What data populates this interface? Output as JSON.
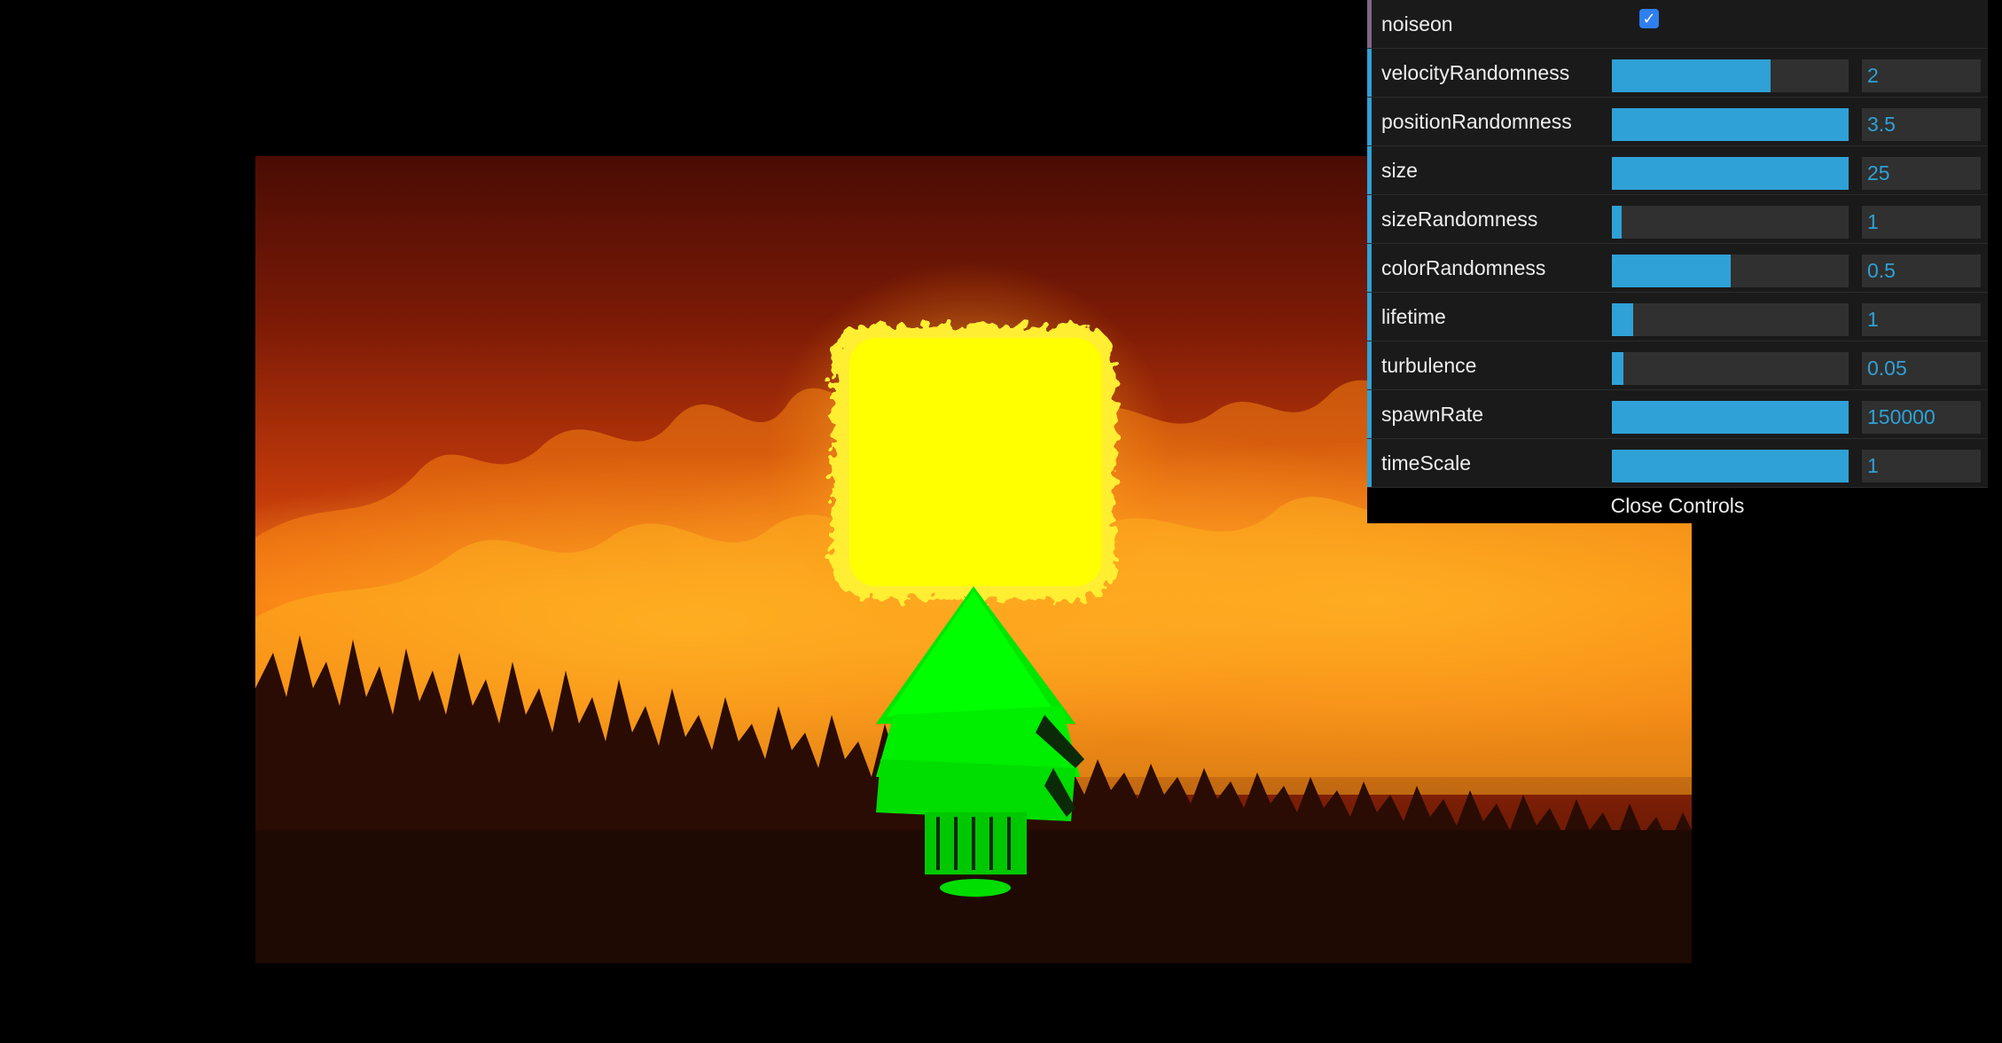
{
  "panel": {
    "toggle": {
      "label": "noiseon",
      "checked": true,
      "check_glyph": "✓"
    },
    "controls": [
      {
        "label": "velocityRandomness",
        "value": "2",
        "fill": 0.67
      },
      {
        "label": "positionRandomness",
        "value": "3.5",
        "fill": 1.0
      },
      {
        "label": "size",
        "value": "25",
        "fill": 1.0
      },
      {
        "label": "sizeRandomness",
        "value": "1",
        "fill": 0.04
      },
      {
        "label": "colorRandomness",
        "value": "0.5",
        "fill": 0.5
      },
      {
        "label": "lifetime",
        "value": "1",
        "fill": 0.09
      },
      {
        "label": "turbulence",
        "value": "0.05",
        "fill": 0.05
      },
      {
        "label": "spawnRate",
        "value": "150000",
        "fill": 1.0
      },
      {
        "label": "timeScale",
        "value": "1",
        "fill": 1.0
      }
    ],
    "close_label": "Close Controls"
  },
  "colors": {
    "accent": "#2fa1d6",
    "toggle_stripe": "#806787",
    "particles": "#ffff00",
    "tree": "#00ff00"
  }
}
